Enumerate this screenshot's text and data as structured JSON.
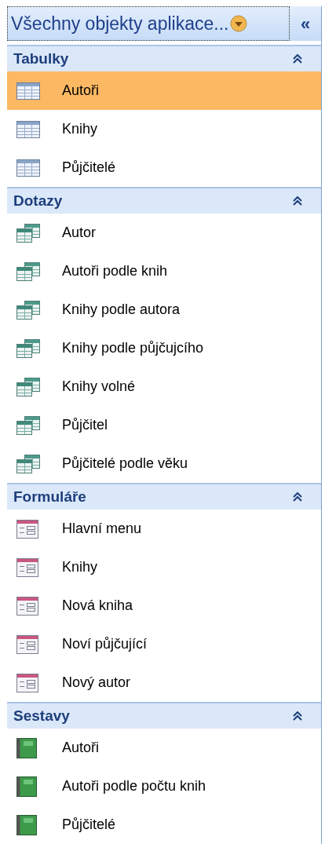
{
  "header": {
    "title": "Všechny objekty aplikace...",
    "collapse": "«"
  },
  "sections": [
    {
      "title": "Tabulky",
      "kind": "table",
      "expanded": true,
      "items": [
        {
          "label": "Autoři",
          "selected": true
        },
        {
          "label": "Knihy",
          "selected": false
        },
        {
          "label": "Půjčitelé",
          "selected": false
        }
      ]
    },
    {
      "title": "Dotazy",
      "kind": "query",
      "expanded": true,
      "items": [
        {
          "label": "Autor",
          "selected": false
        },
        {
          "label": "Autoři podle knih",
          "selected": false
        },
        {
          "label": "Knihy podle autora",
          "selected": false
        },
        {
          "label": "Knihy podle půjčujcího",
          "selected": false
        },
        {
          "label": "Knihy volné",
          "selected": false
        },
        {
          "label": "Půjčitel",
          "selected": false
        },
        {
          "label": "Půjčitelé podle věku",
          "selected": false
        }
      ]
    },
    {
      "title": "Formuláře",
      "kind": "form",
      "expanded": true,
      "items": [
        {
          "label": "Hlavní menu",
          "selected": false
        },
        {
          "label": "Knihy",
          "selected": false
        },
        {
          "label": "Nová kniha",
          "selected": false
        },
        {
          "label": "Noví půjčující",
          "selected": false
        },
        {
          "label": "Nový autor",
          "selected": false
        }
      ]
    },
    {
      "title": "Sestavy",
      "kind": "report",
      "expanded": true,
      "items": [
        {
          "label": "Autoři",
          "selected": false
        },
        {
          "label": "Autoři podle počtu knih",
          "selected": false
        },
        {
          "label": "Půjčitelé",
          "selected": false
        }
      ]
    }
  ]
}
